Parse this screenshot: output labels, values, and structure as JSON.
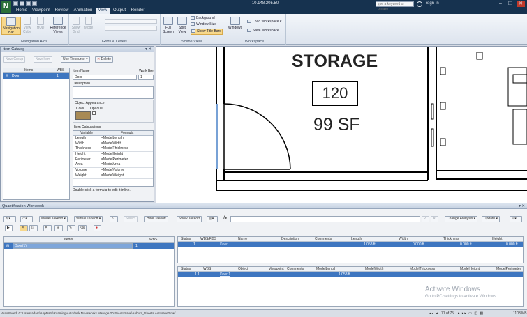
{
  "title_bar": {
    "app_letter": "N",
    "window_title": "10.148.205.50",
    "search_placeholder": "ype a keyword or phrase",
    "sign_in": "Sign In"
  },
  "menu_tabs": [
    "Home",
    "Viewpoint",
    "Review",
    "Animation",
    "View",
    "Output",
    "Render"
  ],
  "active_tab": "View",
  "ribbon": {
    "navigation_aids": {
      "label": "Navigation Aids",
      "buttons": [
        "Navigation Bar",
        "View Cube",
        "HUD",
        "Reference Views"
      ]
    },
    "grids_levels": {
      "label": "Grids & Levels",
      "buttons": [
        "Show Grid",
        "Mode"
      ]
    },
    "scene_view": {
      "label": "Scene View",
      "buttons": [
        "Full Screen",
        "Split View"
      ],
      "options": [
        "Background",
        "Window Size",
        "Show Title Bars"
      ]
    },
    "workspace": {
      "label": "Workspace",
      "windows": "Windows",
      "load": "Load Workspace",
      "save": "Save Workspace"
    }
  },
  "item_catalog": {
    "title": "Item Catalog",
    "toolbar": [
      "New Group",
      "New Item",
      "Use Resource",
      "Delete"
    ],
    "tree_headers": [
      "Items",
      "WBS"
    ],
    "tree_row": {
      "name": "Door",
      "wbs": "1"
    },
    "item_name_label": "Item Name",
    "item_name_value": "Door",
    "work_breakdown_label": "Work Bre",
    "work_breakdown_value": "1",
    "description_label": "Description",
    "appearance": {
      "label": "Object Appearance",
      "color_label": "Color",
      "opaque_label": "Opaque",
      "color": "#a88a55"
    },
    "calculations_label": "Item Calculations",
    "calc_headers": [
      "Variable",
      "Formula"
    ],
    "calc_rows": [
      [
        "Length",
        "=ModelLength"
      ],
      [
        "Width",
        "=ModelWidth"
      ],
      [
        "Thickness",
        "=ModelThickness"
      ],
      [
        "Height",
        "=ModelHeight"
      ],
      [
        "Perimeter",
        "=ModelPerimeter"
      ],
      [
        "Area",
        "=ModelArea"
      ],
      [
        "Volume",
        "=ModelVolume"
      ],
      [
        "Weight",
        "=ModelWeight"
      ]
    ],
    "hint": "Double-click a formula to edit it inline."
  },
  "drawing": {
    "room_name": "STORAGE",
    "room_number": "120",
    "room_area": "99 SF"
  },
  "workbook": {
    "title": "Quantification Workbook",
    "toolbar": [
      "Model Takeoff",
      "Virtual Takeoff",
      "Select",
      "Hide Takeoff",
      "Show Takeoff",
      "Change Analysis",
      "Update"
    ],
    "fx": "fx",
    "tree_headers": [
      "Items",
      "WBS"
    ],
    "tree_row": {
      "name": "Door(1)",
      "wbs": "1"
    },
    "summary_headers": [
      "Status",
      "WBS/RBS",
      "Name",
      "Description",
      "Comments",
      "Length",
      "Width",
      "Thickness",
      "Height"
    ],
    "summary_row": {
      "wbs": "1",
      "name": "Door",
      "length": "1.058 ft",
      "width": "0.000 ft",
      "thickness": "0.000 ft",
      "height": "0.000 ft"
    },
    "detail_headers": [
      "Status",
      "WBS",
      "Object",
      "Viewpoint",
      "Comments",
      "ModelLength",
      "ModelWidth",
      "ModelThickness",
      "ModelHeight",
      "ModelPerimeter"
    ],
    "detail_row": {
      "wbs": "1.1",
      "object": "Door 1",
      "length": "1.058 ft"
    }
  },
  "status_bar": {
    "autosave": "AutoSaved: C:\\Users\\adam\\AppData\\Roaming\\Autodesk Navisworks Manage 2015\\AutoSave\\Auburn_Sheets.Autosave2.nwf",
    "page": "71 of 75",
    "memory": "1103 MB"
  },
  "watermark": {
    "line1": "Activate Windows",
    "line2": "Go to PC settings to activate Windows."
  },
  "colors": {
    "title_bar": "#16324f",
    "selection": "#3e76c0",
    "ribbon_selected": "#f7d88c"
  }
}
